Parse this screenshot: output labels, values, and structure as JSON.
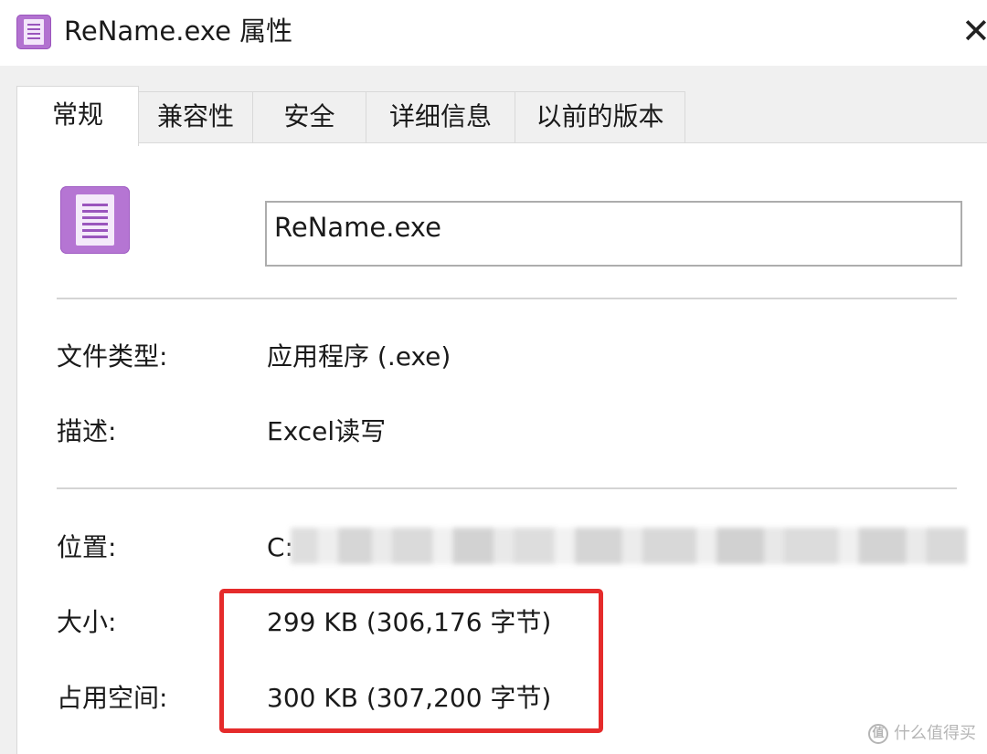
{
  "window": {
    "title": "ReName.exe 属性",
    "close_symbol": "✕"
  },
  "tabs": [
    {
      "label": "常规",
      "active": true
    },
    {
      "label": "兼容性",
      "active": false
    },
    {
      "label": "安全",
      "active": false
    },
    {
      "label": "详细信息",
      "active": false
    },
    {
      "label": "以前的版本",
      "active": false
    }
  ],
  "file": {
    "name": "ReName.exe",
    "icon": "document-icon",
    "icon_color": "#b575d3"
  },
  "properties": {
    "type": {
      "label": "文件类型:",
      "value": "应用程序 (.exe)"
    },
    "description": {
      "label": "描述:",
      "value": "Excel读写"
    },
    "location": {
      "label": "位置:",
      "value": "C:"
    },
    "size": {
      "label": "大小:",
      "value": "299 KB (306,176 字节)"
    },
    "disk_size": {
      "label": "占用空间:",
      "value": "300 KB (307,200 字节)"
    }
  },
  "annotation": {
    "highlight_color": "#e52b2b"
  },
  "watermark": {
    "icon_symbol": "值",
    "text": "什么值得买"
  }
}
